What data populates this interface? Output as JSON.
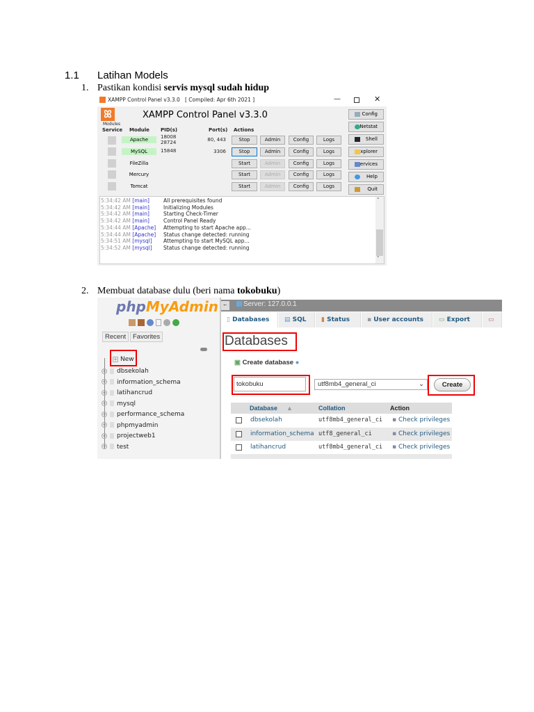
{
  "section": {
    "number": "1.1",
    "title": "Latihan Models"
  },
  "step1": {
    "number": "1.",
    "text": "Pastikan kondisi ",
    "bold": "servis mysql sudah hidup"
  },
  "xampp": {
    "window_title": "XAMPP Control Panel v3.3.0   [ Compiled: Apr 6th 2021 ]",
    "header": "XAMPP Control Panel v3.3.0",
    "modules_label": "Modules",
    "columns": [
      "Service",
      "Module",
      "PID(s)",
      "Port(s)",
      "Actions"
    ],
    "rows": [
      {
        "module": "Apache",
        "pid1": "18008",
        "pid2": "28724",
        "port": "80, 443",
        "action": "Stop",
        "running": true
      },
      {
        "module": "MySQL",
        "pid1": "15848",
        "pid2": "",
        "port": "3306",
        "action": "Stop",
        "running": true
      },
      {
        "module": "FileZilla",
        "pid1": "",
        "pid2": "",
        "port": "",
        "action": "Start",
        "running": false
      },
      {
        "module": "Mercury",
        "pid1": "",
        "pid2": "",
        "port": "",
        "action": "Start",
        "running": false
      },
      {
        "module": "Tomcat",
        "pid1": "",
        "pid2": "",
        "port": "",
        "action": "Start",
        "running": false
      }
    ],
    "admin": "Admin",
    "config": "Config",
    "logs": "Logs",
    "side_buttons": [
      "Config",
      "Netstat",
      "Shell",
      "Explorer",
      "Services",
      "Help",
      "Quit"
    ],
    "log": [
      {
        "time": "5:34:42 AM",
        "src": "[main]",
        "msg": "All prerequisites found"
      },
      {
        "time": "5:34:42 AM",
        "src": "[main]",
        "msg": "Initializing Modules"
      },
      {
        "time": "5:34:42 AM",
        "src": "[main]",
        "msg": "Starting Check-Timer"
      },
      {
        "time": "5:34:42 AM",
        "src": "[main]",
        "msg": "Control Panel Ready"
      },
      {
        "time": "5:34:44 AM",
        "src": "[Apache]",
        "msg": "Attempting to start Apache app..."
      },
      {
        "time": "5:34:44 AM",
        "src": "[Apache]",
        "msg": "Status change detected: running"
      },
      {
        "time": "5:34:51 AM",
        "src": "[mysql]",
        "msg": "Attempting to start MySQL app..."
      },
      {
        "time": "5:34:52 AM",
        "src": "[mysql]",
        "msg": "Status change detected: running"
      }
    ]
  },
  "step2": {
    "number": "2.",
    "text": "Membuat database dulu (beri nama ",
    "bold": "tokobuku",
    ")": ")"
  },
  "pma": {
    "logo_php": "php",
    "logo_rest": "MyAdmin",
    "recent": "Recent",
    "favorites": "Favorites",
    "new": "New",
    "databases_tree": [
      "dbsekolah",
      "information_schema",
      "latihancrud",
      "mysql",
      "performance_schema",
      "phpmyadmin",
      "projectweb1",
      "test"
    ],
    "server": "Server: 127.0.0.1",
    "tabs": [
      "Databases",
      "SQL",
      "Status",
      "User accounts",
      "Export"
    ],
    "heading": "Databases",
    "create_label": "Create database",
    "db_name_value": "tokobuku",
    "collation_value": "utf8mb4_general_ci",
    "create_button": "Create",
    "table_headers": [
      "Database",
      "Collation",
      "Action"
    ],
    "table_rows": [
      {
        "name": "dbsekolah",
        "collation": "utf8mb4_general_ci",
        "action": "Check privileges"
      },
      {
        "name": "information_schema",
        "collation": "utf8_general_ci",
        "action": "Check privileges"
      },
      {
        "name": "latihancrud",
        "collation": "utf8mb4_general_ci",
        "action": "Check privileges"
      }
    ]
  }
}
